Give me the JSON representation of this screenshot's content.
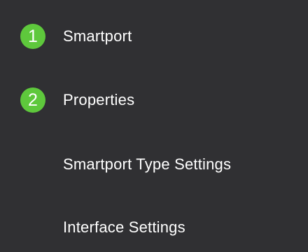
{
  "menu": {
    "items": [
      {
        "label": "Smartport",
        "step": "1",
        "has_step": true
      },
      {
        "label": "Properties",
        "step": "2",
        "has_step": true
      },
      {
        "label": "Smartport Type Settings",
        "has_step": false
      },
      {
        "label": "Interface Settings",
        "has_step": false
      }
    ]
  },
  "colors": {
    "background": "#303033",
    "step_badge": "#5ec83c",
    "text": "#ffffff"
  }
}
